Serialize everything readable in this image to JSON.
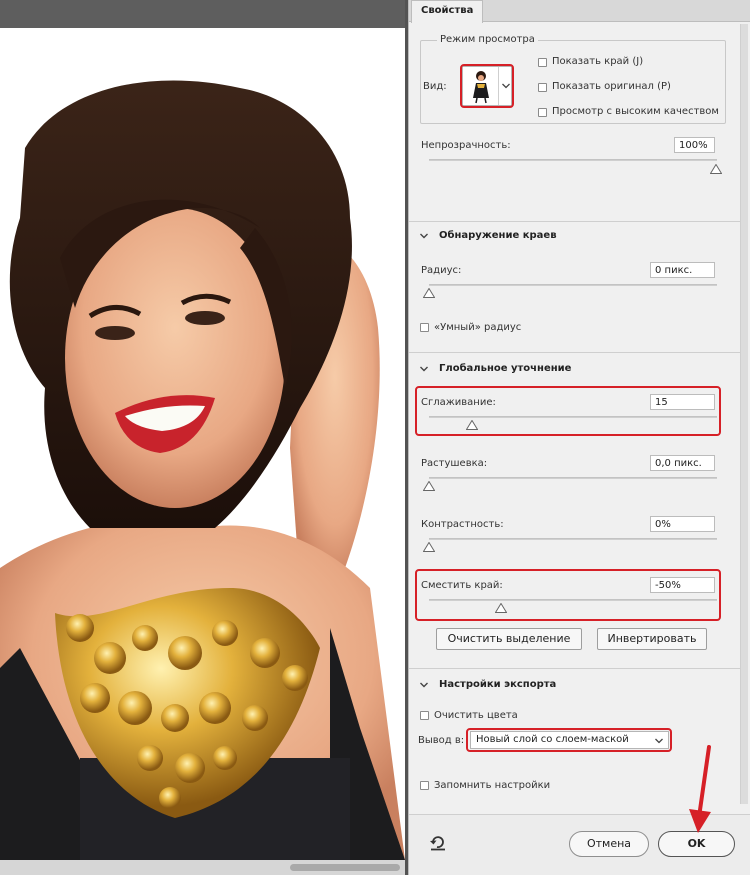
{
  "panel": {
    "tab_label": "Свойства"
  },
  "view_mode": {
    "group_title": "Режим просмотра",
    "view_label": "Вид:",
    "checkboxes": [
      {
        "label": "Показать край (J)",
        "checked": false
      },
      {
        "label": "Показать оригинал (P)",
        "checked": false
      },
      {
        "label": "Просмотр с высоким качеством",
        "checked": false
      }
    ],
    "opacity_label": "Непрозрачность:",
    "opacity_value": "100%",
    "opacity_fraction": 1.0
  },
  "edge_detection": {
    "title": "Обнаружение краев",
    "radius_label": "Радиус:",
    "radius_value": "0 пикс.",
    "radius_fraction": 0.0,
    "smart_radius_label": "«Умный» радиус",
    "smart_radius_checked": false
  },
  "global_refine": {
    "title": "Глобальное уточнение",
    "smooth_label": "Сглаживание:",
    "smooth_value": "15",
    "smooth_fraction": 0.15,
    "feather_label": "Растушевка:",
    "feather_value": "0,0 пикс.",
    "feather_fraction": 0.0,
    "contrast_label": "Контрастность:",
    "contrast_value": "0%",
    "contrast_fraction": 0.0,
    "shift_label": "Сместить край:",
    "shift_value": "-50%",
    "shift_fraction": 0.25,
    "clear_selection_label": "Очистить выделение",
    "invert_label": "Инвертировать"
  },
  "export": {
    "title": "Настройки экспорта",
    "decontaminate_label": "Очистить цвета",
    "decontaminate_checked": false,
    "output_label": "Вывод в:",
    "output_value": "Новый слой со слоем-маской",
    "remember_label": "Запомнить настройки",
    "remember_checked": false
  },
  "footer": {
    "cancel_label": "Отмена",
    "ok_label": "OK"
  },
  "colors": {
    "highlight_red": "#d62027",
    "panel_bg": "#f0f0f0"
  },
  "icons": [
    "chevron-down-icon",
    "reset-icon",
    "dropdown-arrow-icon",
    "slider-thumb-icon",
    "red-arrow-annotation"
  ]
}
